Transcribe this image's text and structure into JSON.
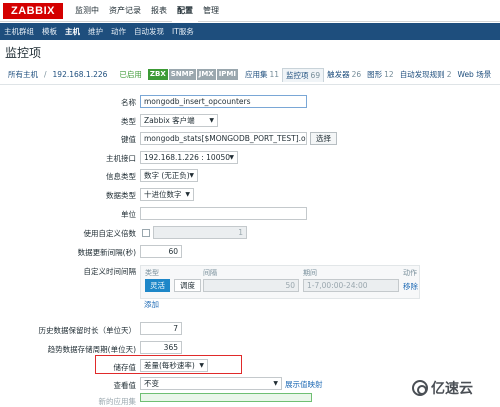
{
  "brand": "ZABBIX",
  "top_menu": [
    "监测中",
    "资产记录",
    "报表",
    "配置",
    "管理"
  ],
  "sub_menu": [
    "主机群组",
    "模板",
    "主机",
    "维护",
    "动作",
    "自动发现",
    "IT服务"
  ],
  "page_title": "监控项",
  "breadcrumb": {
    "all_hosts": "所有主机",
    "sep": "/",
    "host": "192.168.1.226",
    "status": "已启用",
    "badges": [
      "ZBX",
      "SNMP",
      "JMX",
      "IPMI"
    ],
    "tabs": [
      {
        "label": "应用集",
        "count": "11"
      },
      {
        "label": "监控项",
        "count": "69"
      },
      {
        "label": "触发器",
        "count": "26"
      },
      {
        "label": "图形",
        "count": "12"
      },
      {
        "label": "自动发现规则",
        "count": "2"
      },
      {
        "label": "Web 场景",
        "count": ""
      }
    ]
  },
  "form": {
    "name_label": "名称",
    "name_value": "mongodb_insert_opcounters",
    "type_label": "类型",
    "type_value": "Zabbix 客户端",
    "key_label": "键值",
    "key_value": "mongodb_stats[$MONGODB_PORT_TEST].op",
    "key_button": "选择",
    "iface_label": "主机接口",
    "iface_value": "192.168.1.226 : 10050",
    "info_type_label": "信息类型",
    "info_type_value": "数字 (无正负)",
    "data_type_label": "数据类型",
    "data_type_value": "十进位数字",
    "unit_label": "单位",
    "unit_value": "",
    "multiplier_label": "使用自定义倍数",
    "multiplier_value": "1",
    "interval_label": "数据更新间隔(秒)",
    "interval_value": "60",
    "custom_label": "自定义时间间隔",
    "custom_headers": [
      "类型",
      "间隔",
      "期间",
      "动作"
    ],
    "custom_type_on": "灵活",
    "custom_type_off": "调度",
    "custom_interval": "50",
    "custom_period": "1-7,00:00-24:00",
    "custom_remove": "移除",
    "custom_add": "添加",
    "history_label": "历史数据保留时长（单位天）",
    "history_value": "7",
    "trends_label": "趋势数据存储周期(单位天)",
    "trends_value": "365",
    "store_label": "储存值",
    "store_value": "差量(每秒速率)",
    "show_label": "查看值",
    "show_value": "不变",
    "show_link": "展示值映射",
    "cut_label": "新的应用集"
  },
  "watermark": "亿速云"
}
